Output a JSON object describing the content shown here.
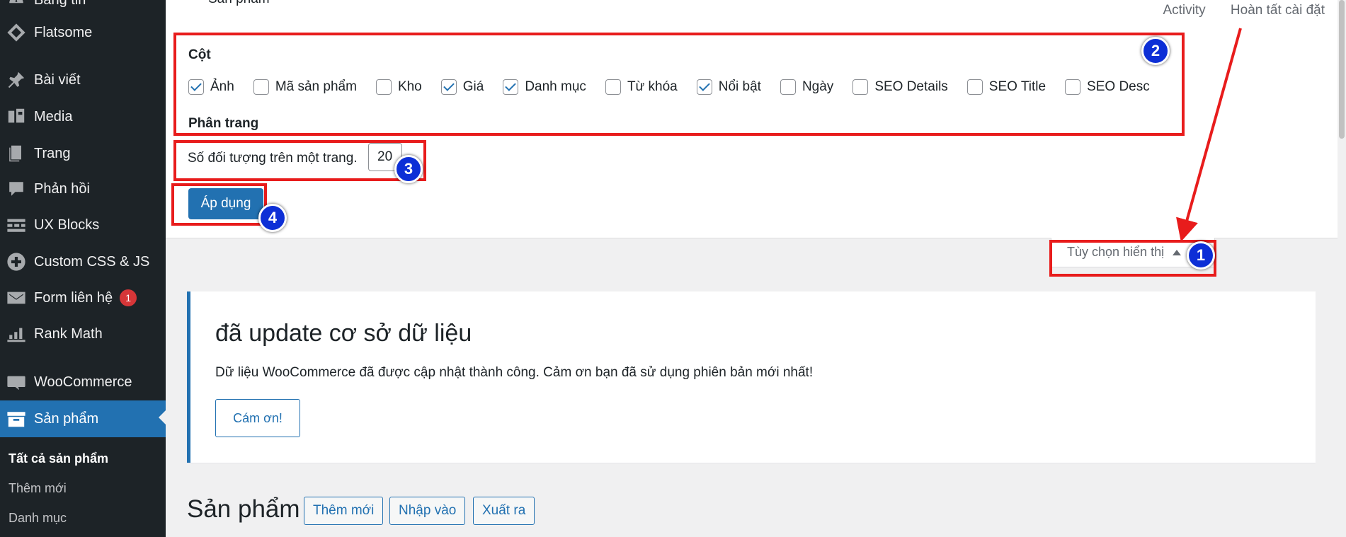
{
  "sidebar": {
    "items": [
      {
        "label": "Bảng tin",
        "icon": "dashboard-icon"
      },
      {
        "label": "Flatsome",
        "icon": "flatsome-icon"
      },
      {
        "label": "Bài viết",
        "icon": "pin-icon"
      },
      {
        "label": "Media",
        "icon": "media-icon"
      },
      {
        "label": "Trang",
        "icon": "page-icon"
      },
      {
        "label": "Phản hồi",
        "icon": "comment-icon"
      },
      {
        "label": "UX Blocks",
        "icon": "blocks-icon"
      },
      {
        "label": "Custom CSS & JS",
        "icon": "plus-circle-icon"
      },
      {
        "label": "Form liên hệ",
        "icon": "mail-icon",
        "badge": "1"
      },
      {
        "label": "Rank Math",
        "icon": "chart-icon"
      },
      {
        "label": "WooCommerce",
        "icon": "woo-icon"
      },
      {
        "label": "Sản phẩm",
        "icon": "archive-icon",
        "active": true
      }
    ],
    "submenu": [
      "Tất cả sản phẩm",
      "Thêm mới",
      "Danh mục"
    ]
  },
  "screen_options": {
    "top_heading": "Sản phẩm",
    "links": [
      "Activity",
      "Hoàn tất cài đặt"
    ],
    "columns_title": "Cột",
    "columns": [
      {
        "label": "Ảnh",
        "checked": true
      },
      {
        "label": "Mã sản phẩm",
        "checked": false
      },
      {
        "label": "Kho",
        "checked": false
      },
      {
        "label": "Giá",
        "checked": true
      },
      {
        "label": "Danh mục",
        "checked": true
      },
      {
        "label": "Từ khóa",
        "checked": false
      },
      {
        "label": "Nổi bật",
        "checked": true
      },
      {
        "label": "Ngày",
        "checked": false
      },
      {
        "label": "SEO Details",
        "checked": false
      },
      {
        "label": "SEO Title",
        "checked": false
      },
      {
        "label": "SEO Desc",
        "checked": false
      }
    ],
    "pagination_title": "Phân trang",
    "per_page_label": "Số đối tượng trên một trang.",
    "per_page_value": "20",
    "apply_label": "Áp dụng",
    "tab_label": "Tùy chọn hiển thị"
  },
  "notice": {
    "title": "đã update cơ sở dữ liệu",
    "text": "Dữ liệu WooCommerce đã được cập nhật thành công. Cảm ơn bạn đã sử dụng phiên bản mới nhất!",
    "button": "Cám ơn!"
  },
  "page": {
    "title": "Sản phẩm",
    "actions": [
      "Thêm mới",
      "Nhập vào",
      "Xuất ra"
    ]
  },
  "annotations": {
    "markers": [
      "1",
      "2",
      "3",
      "4"
    ],
    "color": "#e81c1c",
    "marker_color": "#0d2fd6"
  }
}
